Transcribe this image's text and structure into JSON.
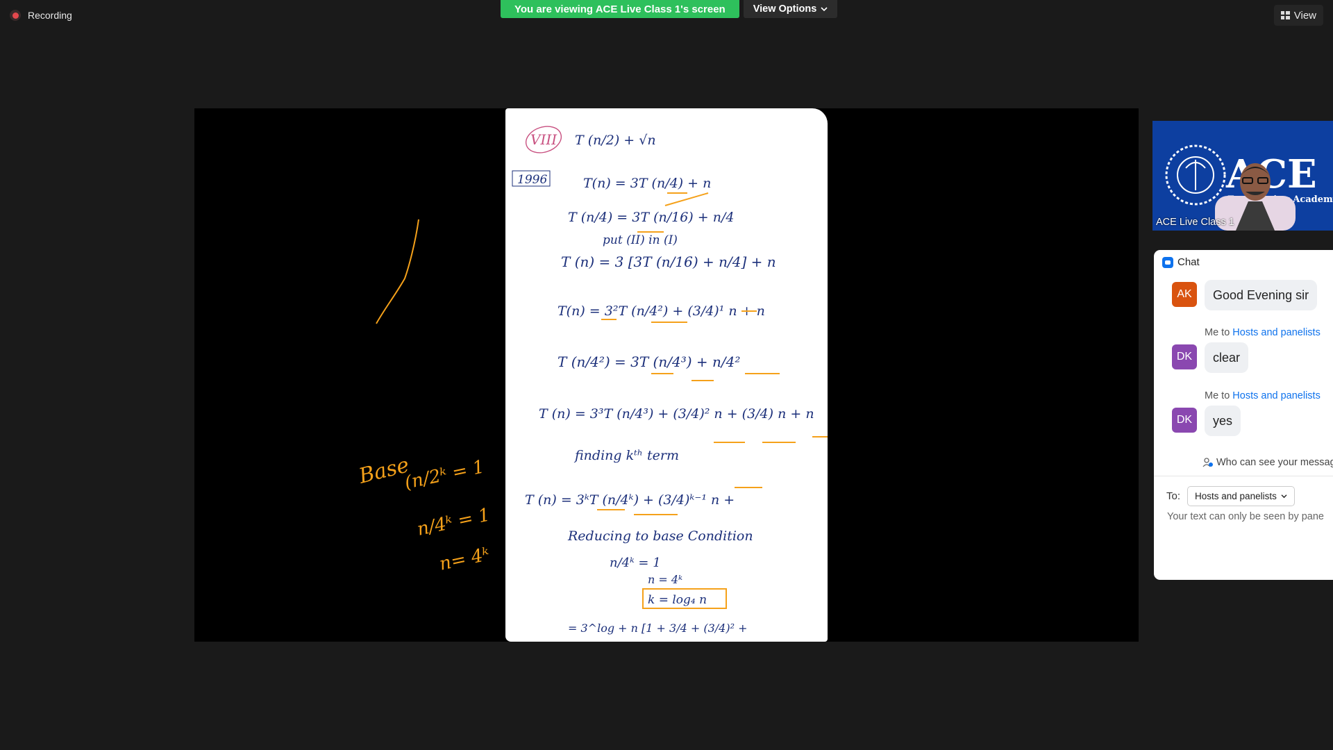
{
  "recording": {
    "label": "Recording"
  },
  "banner": {
    "viewing_text": "You are viewing ACE Live Class 1's screen",
    "view_options_label": "View Options"
  },
  "view_button": {
    "label": "View",
    "icon": "grid-icon"
  },
  "shared_screen": {
    "page_notes": {
      "tag": "VIII",
      "year": "1996",
      "lines": [
        "T (n/2) + √n",
        "T(n) = 3T (n/4) + n",
        "T (n/4) = 3T (n/16) + n/4",
        "put (II) in (I)",
        "T (n) = 3 [3T (n/16) + n/4] + n",
        "T(n) = 3²T (n/4²) + (3/4)¹ n + n",
        "T (n/4²) = 3T (n/4³) + n/4²",
        "T (n) = 3³T (n/4³) + (3/4)² n + (3/4) n + n",
        "finding kᵗʰ term",
        "T (n) = 3ᵏT (n/4ᵏ) + (3/4)ᵏ⁻¹ n +",
        "Reducing to base Condition",
        "n/4ᵏ = 1",
        "n = 4ᵏ",
        "k = log₄ n",
        "= 3^log + n [1 + 3/4 + (3/4)² +"
      ]
    },
    "annotation": {
      "lines": [
        "Base",
        "(n/2ᵏ = 1",
        "n/4ᵏ = 1",
        "n= 4ᵏ"
      ],
      "color": "#f5a11a"
    }
  },
  "participant": {
    "name": "ACE Live Class 1",
    "logo_text": "ACE",
    "logo_sub": "Engineering Academy"
  },
  "chat": {
    "title": "Chat",
    "messages": [
      {
        "initials": "AK",
        "avatar_color": "#d9530f",
        "text": "Good Evening sir",
        "meta": null
      },
      {
        "initials": "DK",
        "avatar_color": "#8a48b0",
        "text": "clear",
        "meta": {
          "prefix": "Me to ",
          "target": "Hosts and panelists"
        }
      },
      {
        "initials": "DK",
        "avatar_color": "#8a48b0",
        "text": "yes",
        "meta": {
          "prefix": "Me to ",
          "target": "Hosts and panelists"
        }
      }
    ],
    "visibility_text": "Who can see your messag",
    "to_label": "To:",
    "to_value": "Hosts and panelists",
    "input_placeholder": "Your text can only be seen by pane"
  }
}
